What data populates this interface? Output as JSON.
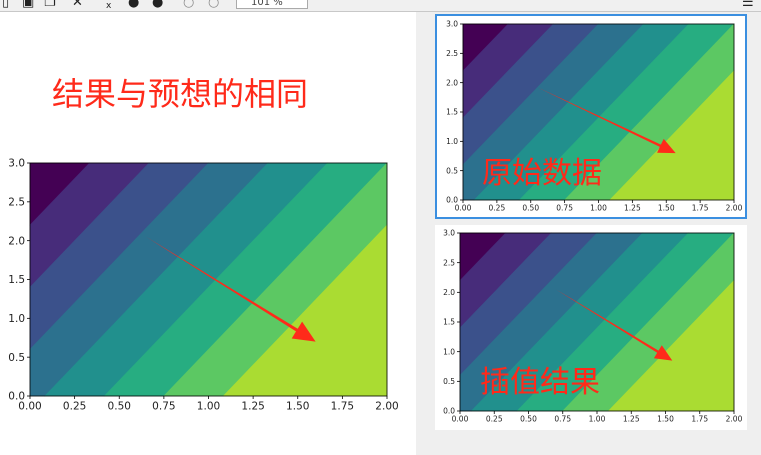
{
  "toolbar": {
    "zoom_value": "101 %",
    "icons": [
      "page-icon",
      "copy-icon",
      "close-icon",
      "small-close-icon",
      "back-icon",
      "forward-icon",
      "zoom-out-icon",
      "zoom-in-icon",
      "menu-icon"
    ]
  },
  "main": {
    "heading": "结果与预想的相同"
  },
  "thumbnails": [
    {
      "label": "原始数据"
    },
    {
      "label": "插值结果"
    }
  ],
  "colors": {
    "arrow": "#ff2a1a",
    "selection_border": "#3b8fe0",
    "levels": [
      "#440154",
      "#472c7a",
      "#3b518b",
      "#2c718e",
      "#21908d",
      "#27ad81",
      "#5cc863",
      "#aadc32",
      "#d4e21a"
    ]
  },
  "chart_data": [
    {
      "type": "contourf",
      "x_ticks": [
        "0.00",
        "0.25",
        "0.50",
        "0.75",
        "1.00",
        "1.25",
        "1.50",
        "1.75",
        "2.00"
      ],
      "y_ticks": [
        "0.0",
        "0.5",
        "1.0",
        "1.5",
        "2.0",
        "2.5",
        "3.0"
      ],
      "xlim": [
        0,
        2
      ],
      "ylim": [
        0,
        3
      ],
      "contour_levels": [
        0.8,
        1.6,
        2.4,
        3.2,
        4.0,
        4.8,
        5.6
      ],
      "arrow": {
        "from": [
          0.65,
          2.05
        ],
        "to": [
          1.6,
          0.7
        ]
      }
    },
    {
      "type": "contourf",
      "x_ticks": [
        "0.00",
        "0.25",
        "0.50",
        "0.75",
        "1.00",
        "1.25",
        "1.50",
        "1.75",
        "2.00"
      ],
      "y_ticks": [
        "0.0",
        "0.5",
        "1.0",
        "1.5",
        "2.0",
        "2.5",
        "3.0"
      ],
      "xlim": [
        0,
        2
      ],
      "ylim": [
        0,
        3
      ],
      "contour_levels": [
        0.8,
        1.6,
        2.4,
        3.2,
        4.0,
        4.8,
        5.6
      ],
      "arrow": {
        "from": [
          0.55,
          1.92
        ],
        "to": [
          1.57,
          0.8
        ]
      }
    },
    {
      "type": "contourf",
      "x_ticks": [
        "0.00",
        "0.25",
        "0.50",
        "0.75",
        "1.00",
        "1.25",
        "1.50",
        "1.75",
        "2.00"
      ],
      "y_ticks": [
        "0.0",
        "0.5",
        "1.0",
        "1.5",
        "2.0",
        "2.5",
        "3.0"
      ],
      "xlim": [
        0,
        2
      ],
      "ylim": [
        0,
        3
      ],
      "contour_levels": [
        0.8,
        1.6,
        2.4,
        3.2,
        4.0,
        4.8,
        5.6
      ],
      "arrow": {
        "from": [
          0.7,
          2.05
        ],
        "to": [
          1.55,
          0.85
        ]
      }
    }
  ]
}
